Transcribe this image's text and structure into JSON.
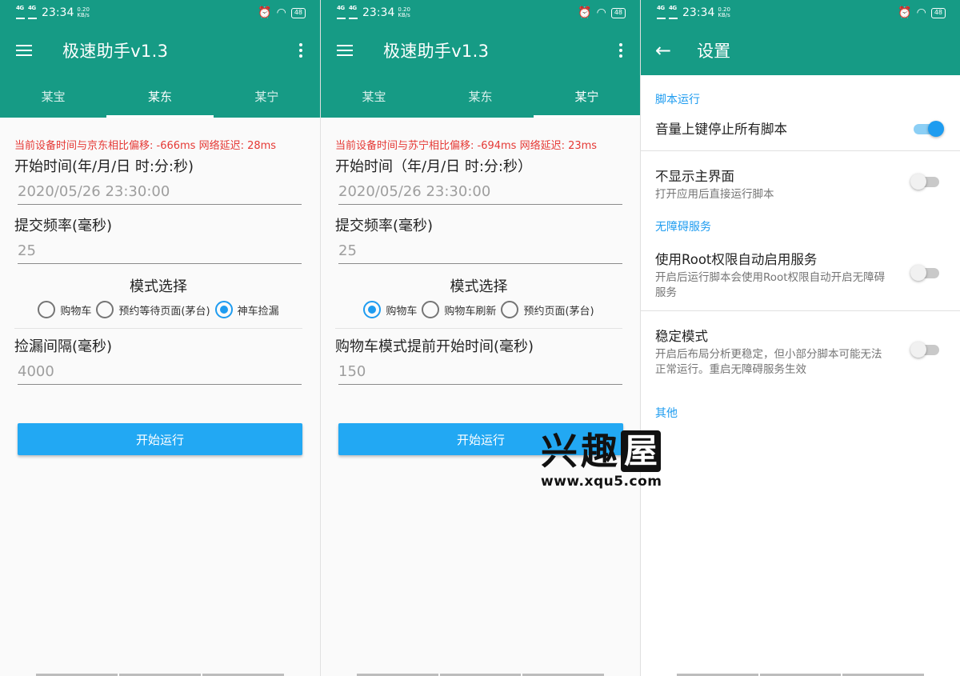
{
  "status": {
    "net1": "4G",
    "net2": "4G",
    "time": "23:34",
    "speed": "0.20",
    "speed_unit": "KB/s",
    "battery": "48"
  },
  "app": {
    "title": "极速助手v1.3"
  },
  "tabs": [
    "某宝",
    "某东",
    "某宁"
  ],
  "panel1": {
    "offset_text": "当前设备时间与京东相比偏移: -666ms 网络延迟: 28ms",
    "start_label": "开始时间(年/月/日 时:分:秒)",
    "start_value": "2020/05/26 23:30:00",
    "freq_label": "提交频率(毫秒)",
    "freq_value": "25",
    "mode_label": "模式选择",
    "radios": [
      "购物车",
      "预约等待页面(茅台)",
      "神车捡漏"
    ],
    "interval_label": "捡漏间隔(毫秒)",
    "interval_value": "4000",
    "start_button": "开始运行"
  },
  "panel2": {
    "offset_text": "当前设备时间与苏宁相比偏移: -694ms 网络延迟: 23ms",
    "start_label": "开始时间（年/月/日 时:分:秒）",
    "start_value": "2020/05/26 23:30:00",
    "freq_label": "提交频率(毫秒)",
    "freq_value": "25",
    "mode_label": "模式选择",
    "radios": [
      "购物车",
      "购物车刷新",
      "预约页面(茅台)"
    ],
    "advance_label": "购物车模式提前开始时间(毫秒)",
    "advance_value": "150",
    "start_button": "开始运行"
  },
  "settings": {
    "title": "设置",
    "section1": "脚本运行",
    "item1_title": "音量上键停止所有脚本",
    "item2_title": "不显示主界面",
    "item2_sub": "打开应用后直接运行脚本",
    "section2": "无障碍服务",
    "item3_title": "使用Root权限自动启用服务",
    "item3_sub": "开启后运行脚本会使用Root权限自动开启无障碍服务",
    "item4_title": "稳定模式",
    "item4_sub": "开启后布局分析更稳定，但小部分脚本可能无法正常运行。重启无障碍服务生效",
    "section3": "其他"
  },
  "watermark": {
    "chars": [
      "兴",
      "趣",
      "屋"
    ],
    "url": "www.xqu5.com"
  },
  "colors": {
    "primary": "#169b85",
    "accent": "#1e9cf0",
    "error": "#e53935",
    "button": "#22a8f3"
  }
}
